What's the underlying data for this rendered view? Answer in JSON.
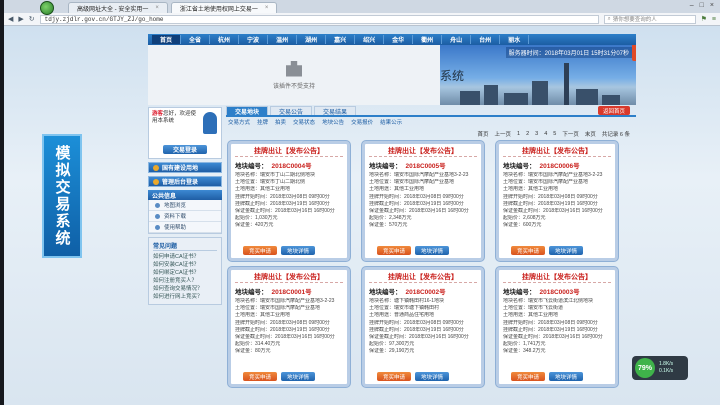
{
  "browser": {
    "tabs": [
      {
        "label": "高级网址大全 - 安全实用一",
        "active": false
      },
      {
        "label": "浙江省土地使用权网上交易一",
        "active": true
      }
    ],
    "url": "tdjy.zjdlr.gov.cn/GTJY_ZJ/go_home",
    "search_placeholder": "猜你想要查询的人",
    "ext_label": "外"
  },
  "topnav": [
    "首页",
    "全省",
    "杭州",
    "宁波",
    "温州",
    "湖州",
    "嘉兴",
    "绍兴",
    "金华",
    "衢州",
    "舟山",
    "台州",
    "丽水"
  ],
  "banner": {
    "plugin_text": "该插件不受支持",
    "server_date": "服务器时间：2018年03月01日 15时31分07秒",
    "system_text": "系统"
  },
  "sidebar_art_text": "模拟交易系统",
  "user": {
    "greeting_name": "游客",
    "greeting_rest": "您好，欢迎使用本系统",
    "login_label": "交易登录"
  },
  "side_buttons": [
    "国有建设用地",
    "管理后台登录"
  ],
  "public_info": {
    "title": "公共信息",
    "items": [
      "地图浏览",
      "资料下载",
      "使用帮助"
    ]
  },
  "faq": {
    "title": "常见问题",
    "items": [
      "如何申请CA证书？",
      "如何安装CA证书？",
      "如何绑定CA证书？",
      "如何注册竞买人？",
      "如何查询交易情况？",
      "如何进行网上竞买？"
    ]
  },
  "main_tabs": [
    "交易地块",
    "交易公告",
    "交易结果"
  ],
  "return_label": "返回首页",
  "subnav": [
    "交易方式",
    "挂牌",
    "拍卖",
    "交易状态",
    "地块公告",
    "交易报价",
    "结果公示"
  ],
  "pager": [
    "首页",
    "上一页",
    "1",
    "2",
    "3",
    "4",
    "5",
    "下一页",
    "末页",
    "共记录 6 条"
  ],
  "cards": [
    {
      "title": "挂牌出让【发布公告】",
      "no_label": "地块编号：",
      "no": "2018C0004号",
      "lines": [
        "地块名称：瑞安市丁山二期北侧地块",
        "土地位置：瑞安市丁山二期北侧",
        "土地用途：其他工业用地",
        "挂牌开始时间：2018年03月08日 09时00分",
        "挂牌截止时间：2018年03月19日 16时00分",
        "保证金截止时间：2018年03月16日 16时00分",
        "起始价：1,030万元",
        "保证金：420万元"
      ],
      "apply": "竞买申请",
      "detail": "地块详情"
    },
    {
      "title": "挂牌出让【发布公告】",
      "no_label": "地块编号：",
      "no": "2018C0005号",
      "lines": [
        "地块名称：瑞安市国际汽摩配产业基地3-2-23",
        "土地位置：瑞安市国际汽摩配产业基地",
        "土地用途：其他工业用地",
        "挂牌开始时间：2018年03月08日 09时00分",
        "挂牌截止时间：2018年03月19日 16时00分",
        "保证金截止时间：2018年03月16日 16时00分",
        "起始价：2,348万元",
        "保证金：570万元"
      ],
      "apply": "竞买申请",
      "detail": "地块详情"
    },
    {
      "title": "挂牌出让【发布公告】",
      "no_label": "地块编号：",
      "no": "2018C0006号",
      "lines": [
        "地块名称：瑞安市国际汽摩配产业基地3-2-23",
        "土地位置：瑞安市国际汽摩配产业基地",
        "土地用途：其他工业用地",
        "挂牌开始时间：2018年03月08日 09时00分",
        "挂牌截止时间：2018年03月19日 16时00分",
        "保证金截止时间：2018年03月16日 16时00分",
        "起始价：2,608万元",
        "保证金：600万元"
      ],
      "apply": "竞买申请",
      "detail": "地块详情"
    },
    {
      "title": "挂牌出让【发布公告】",
      "no_label": "地块编号：",
      "no": "2018C0001号",
      "lines": [
        "地块名称：瑞安市国际汽摩配产业基地3-2-23",
        "土地位置：瑞安市国际汽摩配产业基地",
        "土地用途：其他工业用地",
        "挂牌开始时间：2018年03月08日 09时00分",
        "挂牌截止时间：2018年03月19日 16时00分",
        "保证金截止时间：2018年03月16日 16时00分",
        "起始价：314.40万元",
        "保证金：80万元"
      ],
      "apply": "竞买申请",
      "detail": "地块详情"
    },
    {
      "title": "挂牌出让【发布公告】",
      "no_label": "地块编号：",
      "no": "2018C0002号",
      "lines": [
        "地块名称：塘下镇韩田村16-1地块",
        "土地位置：瑞安市塘下镇韩田村",
        "土地用途：普通商品住宅用地",
        "挂牌开始时间：2018年03月08日 09时00分",
        "挂牌截止时间：2018年03月19日 16时00分",
        "保证金截止时间：2018年03月16日 16时00分",
        "起始价：97,300万元",
        "保证金：29,190万元"
      ],
      "apply": "竞买申请",
      "detail": "地块详情"
    },
    {
      "title": "挂牌出让【发布公告】",
      "no_label": "地块编号：",
      "no": "2018C0003号",
      "lines": [
        "地块名称：瑞安市飞云街道滨江北侧地块",
        "土地位置：瑞安市飞云街道",
        "土地用途：其他工业用地",
        "挂牌开始时间：2018年03月08日 09时00分",
        "挂牌截止时间：2018年03月19日 16时00分",
        "保证金截止时间：2018年03月16日 16时00分",
        "起始价：1,741万元",
        "保证金：348.2万元"
      ],
      "apply": "竞买申请",
      "detail": "地块详情"
    }
  ],
  "widget": {
    "percent": "79%",
    "up": "1.8K/s",
    "down": "0.1K/s"
  }
}
